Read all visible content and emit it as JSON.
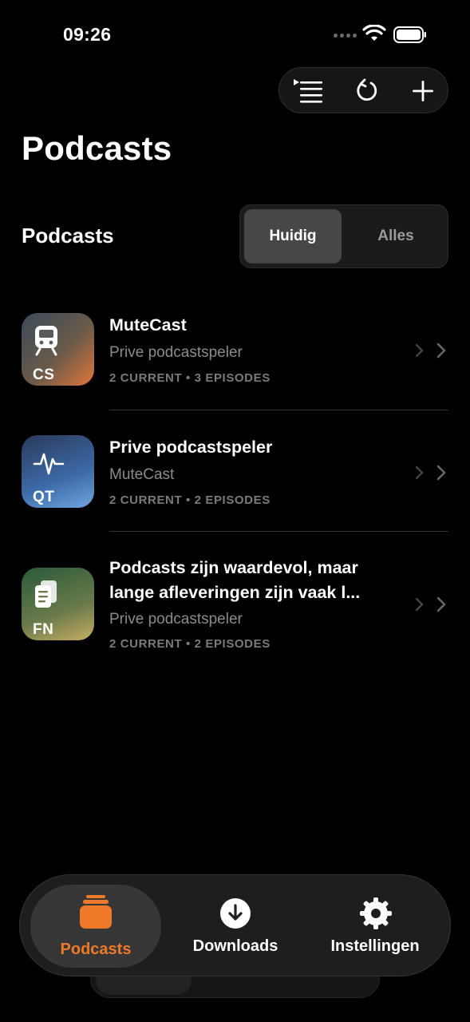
{
  "status_bar": {
    "time": "09:26"
  },
  "header": {
    "title": "Podcasts"
  },
  "toolbar": {
    "queue_icon": "list-queue-icon",
    "refresh_icon": "refresh-icon",
    "add_icon": "plus-icon"
  },
  "section": {
    "title": "Podcasts",
    "segments": [
      "Huidig",
      "Alles"
    ],
    "selected_segment": "Huidig"
  },
  "podcasts": [
    {
      "title": "MuteCast",
      "subtitle": "Prive podcastspeler",
      "meta": "2 CURRENT • 3 EPISODES",
      "code": "CS",
      "icon": "train-icon"
    },
    {
      "title": "Prive podcastspeler",
      "subtitle": "MuteCast",
      "meta": "2 CURRENT • 2 EPISODES",
      "code": "QT",
      "icon": "waveform-icon"
    },
    {
      "title": "Podcasts zijn waardevol, maar lange afleveringen zijn vaak l...",
      "subtitle": "Prive podcastspeler",
      "meta": "2 CURRENT • 2 EPISODES",
      "code": "FN",
      "icon": "document-icon"
    }
  ],
  "tabs": [
    {
      "label": "Podcasts",
      "icon": "stack-icon",
      "active": true
    },
    {
      "label": "Downloads",
      "icon": "download-circle-icon",
      "active": false
    },
    {
      "label": "Instellingen",
      "icon": "gear-icon",
      "active": false
    }
  ],
  "colors": {
    "accent": "#F07A2A",
    "background": "#000000",
    "secondary_text": "#8B8B8B"
  }
}
